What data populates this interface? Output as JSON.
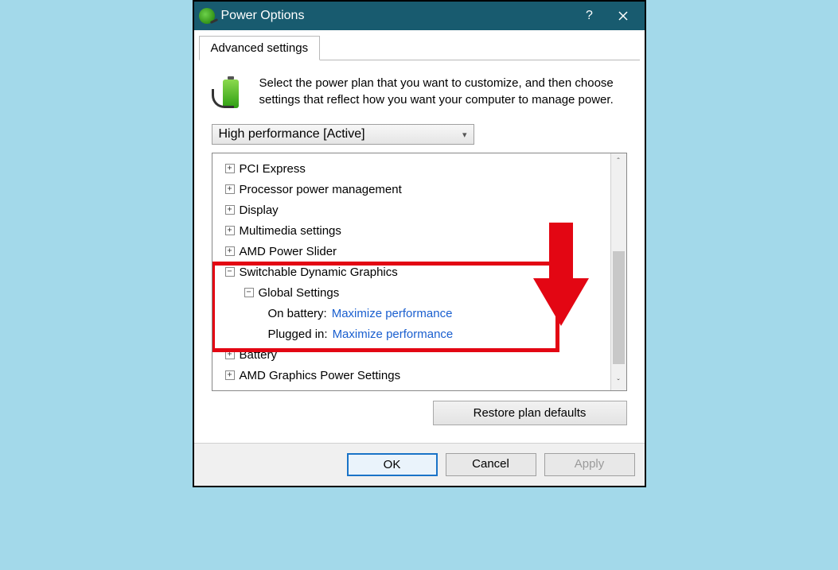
{
  "window": {
    "title": "Power Options"
  },
  "tab": {
    "label": "Advanced settings"
  },
  "intro": {
    "text": "Select the power plan that you want to customize, and then choose settings that reflect how you want your computer to manage power."
  },
  "plan_select": {
    "value": "High performance [Active]"
  },
  "tree": {
    "items": [
      {
        "expander": "+",
        "label": "PCI Express",
        "indent": 1
      },
      {
        "expander": "+",
        "label": "Processor power management",
        "indent": 1
      },
      {
        "expander": "+",
        "label": "Display",
        "indent": 1
      },
      {
        "expander": "+",
        "label": "Multimedia settings",
        "indent": 1
      },
      {
        "expander": "+",
        "label": "AMD Power Slider",
        "indent": 1
      },
      {
        "expander": "−",
        "label": "Switchable Dynamic Graphics",
        "indent": 1
      },
      {
        "expander": "−",
        "label": "Global Settings",
        "indent": 2
      },
      {
        "label": "On battery:",
        "value": "Maximize performance",
        "indent": 3
      },
      {
        "label": "Plugged in:",
        "value": "Maximize performance",
        "indent": 3
      },
      {
        "expander": "+",
        "label": "Battery",
        "indent": 1
      },
      {
        "expander": "+",
        "label": "AMD Graphics Power Settings",
        "indent": 1
      }
    ]
  },
  "restore": {
    "label": "Restore plan defaults"
  },
  "buttons": {
    "ok": "OK",
    "cancel": "Cancel",
    "apply": "Apply"
  }
}
